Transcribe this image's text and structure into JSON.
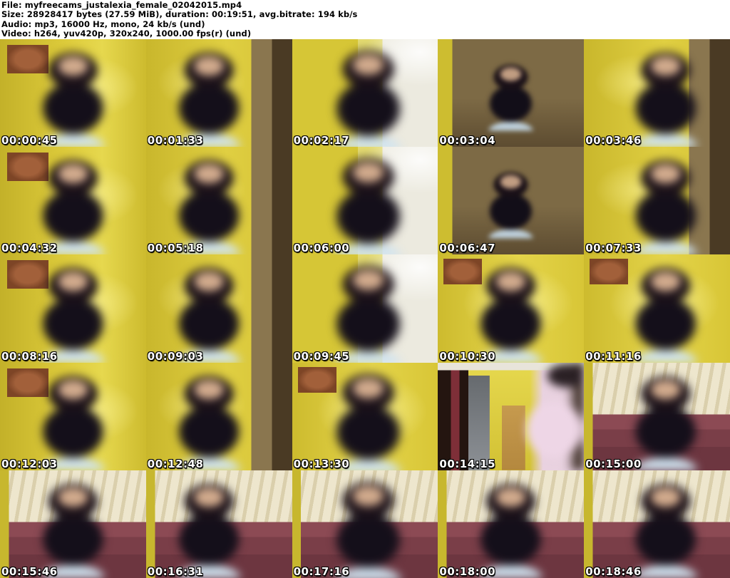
{
  "header": {
    "lines": [
      "File: myfreecams_justalexia_female_02042015.mp4",
      "Size: 28928417 bytes (27.59 MiB), duration: 00:19:51, avg.bitrate: 194 kb/s",
      "Audio: mp3, 16000 Hz, mono, 24 kb/s (und)",
      "Video: h264, yuv420p, 320x240, 1000.00 fps(r) (und)"
    ]
  },
  "grid": {
    "rows": 5,
    "cols": 5,
    "thumb_width": 205,
    "thumb_height": 151
  },
  "thumbnails": [
    {
      "timestamp": "00:00:45",
      "scene": "yellow-a"
    },
    {
      "timestamp": "00:01:33",
      "scene": "yellow-b"
    },
    {
      "timestamp": "00:02:17",
      "scene": "bright"
    },
    {
      "timestamp": "00:03:04",
      "scene": "hall"
    },
    {
      "timestamp": "00:03:46",
      "scene": "yellow-b"
    },
    {
      "timestamp": "00:04:32",
      "scene": "yellow-a"
    },
    {
      "timestamp": "00:05:18",
      "scene": "yellow-b"
    },
    {
      "timestamp": "00:06:00",
      "scene": "bright"
    },
    {
      "timestamp": "00:06:47",
      "scene": "hall"
    },
    {
      "timestamp": "00:07:33",
      "scene": "yellow-b"
    },
    {
      "timestamp": "00:08:16",
      "scene": "yellow-a"
    },
    {
      "timestamp": "00:09:03",
      "scene": "yellow-b"
    },
    {
      "timestamp": "00:09:45",
      "scene": "bright"
    },
    {
      "timestamp": "00:10:30",
      "scene": "yellow-c"
    },
    {
      "timestamp": "00:11:16",
      "scene": "yellow-c"
    },
    {
      "timestamp": "00:12:03",
      "scene": "yellow-a"
    },
    {
      "timestamp": "00:12:48",
      "scene": "yellow-b"
    },
    {
      "timestamp": "00:13:30",
      "scene": "yellow-c"
    },
    {
      "timestamp": "00:14:15",
      "scene": "room"
    },
    {
      "timestamp": "00:15:00",
      "scene": "couch"
    },
    {
      "timestamp": "00:15:46",
      "scene": "couch"
    },
    {
      "timestamp": "00:16:31",
      "scene": "couch"
    },
    {
      "timestamp": "00:17:16",
      "scene": "couch"
    },
    {
      "timestamp": "00:18:00",
      "scene": "couch"
    },
    {
      "timestamp": "00:18:46",
      "scene": "couch"
    }
  ],
  "colors": {
    "header_bg": "#ffffff",
    "header_text": "#000000",
    "wall_yellow": "#ddcb3b",
    "wardrobe_tan": "#8a764f",
    "wardrobe_dark": "#4a3a24",
    "curtain_cream": "#e9e1c6",
    "couch_maroon": "#8c4a54",
    "door_wood": "#c69a4e",
    "cabinet_gray": "#8d9196",
    "fabric_pink": "#e9d2e0",
    "timestamp_text": "#ffffff",
    "timestamp_outline": "#000000"
  }
}
